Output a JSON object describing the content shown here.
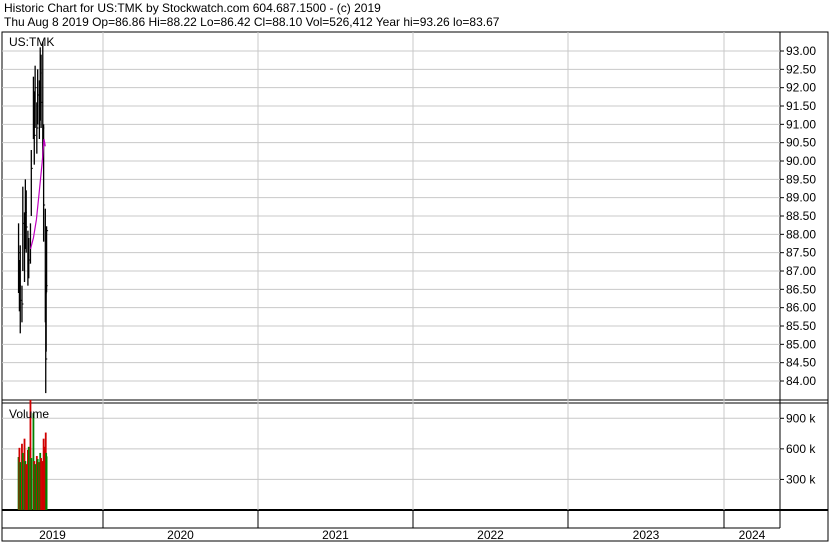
{
  "header": {
    "line1": "Historic Chart for US:TMK by Stockwatch.com 604.687.1500 - (c) 2019",
    "line2": "Thu Aug  8 2019   Op=86.86   Hi=88.22   Lo=86.42   Cl=88.10   Vol=526,412   Year hi=93.26   lo=83.67"
  },
  "chart_data": [
    {
      "type": "line",
      "title": "US:TMK",
      "ylim": [
        83.67,
        93.26
      ],
      "y_ticks": [
        "93.00",
        "92.50",
        "92.00",
        "91.50",
        "91.00",
        "90.50",
        "90.00",
        "89.50",
        "89.00",
        "88.50",
        "88.00",
        "87.50",
        "87.00",
        "86.50",
        "86.00",
        "85.50",
        "85.00",
        "84.50",
        "84.00"
      ],
      "x_ticks": [
        "2019",
        "2020",
        "2021",
        "2022",
        "2023",
        "2024"
      ],
      "grid": true,
      "series": [
        {
          "color": "#000000",
          "x": [
            "2019-06-03",
            "2019-06-05",
            "2019-06-07",
            "2019-06-11",
            "2019-06-13",
            "2019-06-17",
            "2019-06-19",
            "2019-06-21",
            "2019-06-25",
            "2019-06-27",
            "2019-07-01",
            "2019-07-03",
            "2019-07-08",
            "2019-07-10",
            "2019-07-12",
            "2019-07-16",
            "2019-07-18",
            "2019-07-22",
            "2019-07-24",
            "2019-07-26",
            "2019-07-30",
            "2019-08-01",
            "2019-08-05",
            "2019-08-06",
            "2019-08-07",
            "2019-08-08"
          ],
          "high": [
            88.3,
            87.3,
            87.7,
            86.6,
            89.3,
            88.6,
            89.5,
            89.2,
            88.1,
            87.9,
            88.3,
            90.3,
            92.3,
            91.9,
            92.6,
            91.6,
            92.5,
            92.2,
            93.1,
            92.9,
            93.26,
            91.0,
            88.7,
            86.2,
            86.9,
            88.22
          ],
          "low": [
            86.4,
            85.9,
            85.3,
            85.6,
            87.0,
            86.7,
            87.6,
            87.5,
            86.6,
            86.8,
            87.2,
            88.5,
            90.6,
            89.9,
            90.9,
            90.2,
            91.0,
            90.6,
            91.1,
            90.9,
            90.1,
            87.8,
            85.6,
            83.67,
            84.8,
            86.42
          ],
          "close": [
            87.5,
            86.6,
            86.2,
            86.1,
            88.3,
            87.7,
            88.6,
            88.2,
            87.2,
            87.3,
            87.7,
            89.8,
            91.6,
            90.7,
            92.0,
            90.9,
            91.8,
            91.5,
            92.4,
            91.6,
            90.9,
            88.8,
            86.4,
            84.6,
            86.6,
            88.1
          ]
        },
        {
          "color": "#c000c0",
          "x": [
            "2019-07-01",
            "2019-07-08",
            "2019-07-15",
            "2019-07-22",
            "2019-07-29",
            "2019-08-02",
            "2019-08-05"
          ],
          "values": [
            87.6,
            87.9,
            88.4,
            89.2,
            90.0,
            90.6,
            90.4
          ]
        }
      ]
    },
    {
      "type": "bar",
      "title": "Volume",
      "y_ticks": [
        "900 k",
        "600 k",
        "300 k"
      ],
      "ylim": [
        0,
        1050000
      ],
      "grid": true,
      "x": [
        "2019-06-03",
        "2019-06-05",
        "2019-06-07",
        "2019-06-11",
        "2019-06-13",
        "2019-06-17",
        "2019-06-19",
        "2019-06-21",
        "2019-06-25",
        "2019-06-27",
        "2019-07-01",
        "2019-07-03",
        "2019-07-08",
        "2019-07-10",
        "2019-07-12",
        "2019-07-16",
        "2019-07-18",
        "2019-07-22",
        "2019-07-24",
        "2019-07-26",
        "2019-07-30",
        "2019-08-01",
        "2019-08-05",
        "2019-08-06",
        "2019-08-07",
        "2019-08-08"
      ],
      "values": [
        520000,
        610000,
        470000,
        650000,
        560000,
        700000,
        480000,
        450000,
        590000,
        620000,
        1080000,
        510000,
        950000,
        480000,
        450000,
        530000,
        500000,
        470000,
        560000,
        510000,
        480000,
        700000,
        620000,
        760000,
        560000,
        526412
      ],
      "colors": [
        "#008000",
        "#d00000",
        "#008000",
        "#d00000",
        "#008000",
        "#d00000",
        "#008000",
        "#d00000",
        "#d00000",
        "#008000",
        "#d00000",
        "#008000",
        "#008000",
        "#d00000",
        "#008000",
        "#d00000",
        "#008000",
        "#d00000",
        "#008000",
        "#d00000",
        "#d00000",
        "#d00000",
        "#d00000",
        "#d00000",
        "#008000",
        "#008000"
      ]
    }
  ]
}
